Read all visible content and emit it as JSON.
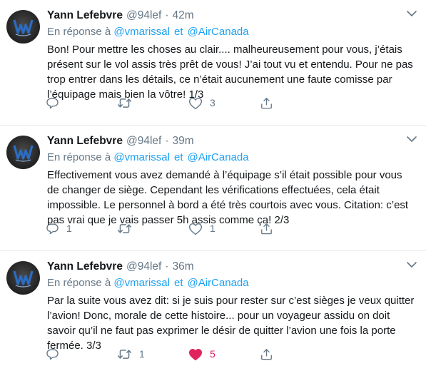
{
  "tweets": [
    {
      "name": "Yann Lefebvre",
      "handle": "@94lef",
      "dot": "·",
      "time": "42m",
      "reply_prefix": "En réponse à",
      "mention1": "@vmarissal",
      "connector": "et",
      "mention2": "@AirCanada",
      "text": "Bon! Pour mettre les choses au clair.... malheureusement pour vous, j’étais présent sur le vol assis très prêt de vous! J’ai tout vu et entendu. Pour ne pas trop entrer dans les détails, ce n’était aucunement une faute comisse par l’équipage mais bien la vôtre! 1/3",
      "reply_count": "",
      "retweet_count": "",
      "like_count": "3",
      "liked": false
    },
    {
      "name": "Yann Lefebvre",
      "handle": "@94lef",
      "dot": "·",
      "time": "39m",
      "reply_prefix": "En réponse à",
      "mention1": "@vmarissal",
      "connector": "et",
      "mention2": "@AirCanada",
      "text": "Effectivement vous avez demandé à l’équipage s’il était possible pour vous de changer de siège. Cependant les vérifications effectuées, cela était impossible. Le personnel à bord a été très courtois avec vous. Citation: c’est pas vrai que je vais passer 5h assis comme ça! 2/3",
      "reply_count": "1",
      "retweet_count": "",
      "like_count": "1",
      "liked": false
    },
    {
      "name": "Yann Lefebvre",
      "handle": "@94lef",
      "dot": "·",
      "time": "36m",
      "reply_prefix": "En réponse à",
      "mention1": "@vmarissal",
      "connector": "et",
      "mention2": "@AirCanada",
      "text": "Par la suite vous avez dit: si je suis pour rester sur c’est sièges je veux quitter l’avion! Donc, morale de cette histoire... pour un voyageur assidu on doit savoir qu’il ne faut pas exprimer le désir de quitter l’avion une fois la porte fermée. 3/3",
      "reply_count": "",
      "retweet_count": "1",
      "like_count": "5",
      "liked": true
    }
  ],
  "icons": {
    "avatar": "avatar-logo",
    "reply": "reply-icon",
    "retweet": "retweet-icon",
    "like": "heart-icon",
    "share": "share-icon",
    "menu": "chevron-down-icon"
  },
  "colors": {
    "mention": "#1da1f2",
    "secondary_text": "#657786",
    "liked": "#e0245e"
  }
}
